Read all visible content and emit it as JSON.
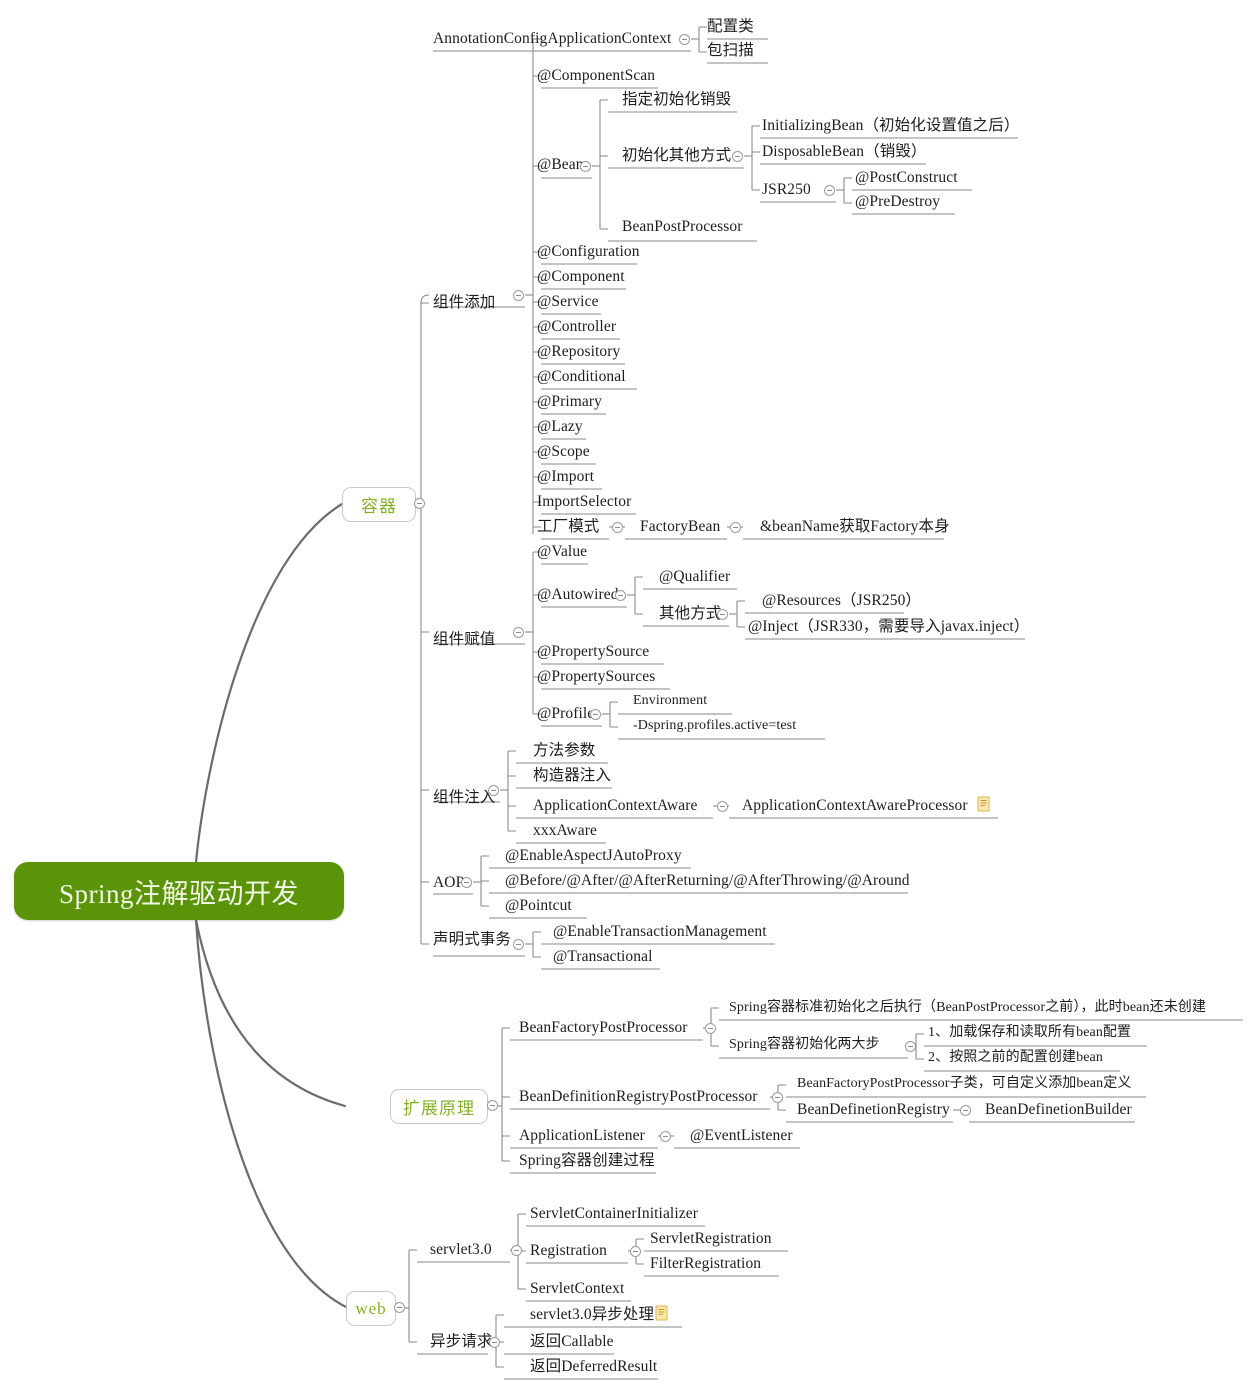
{
  "meta": {
    "title": "Spring注解驱动开发",
    "colors": {
      "root_bg": "#5b9409",
      "root_text": "#f2f7e6",
      "branch_text": "#84b12a",
      "branch_border": "#c9c9c9",
      "line": "#6b6b6b",
      "topic_text": "#1d1d1d",
      "note_icon": "#e8c45c"
    }
  },
  "root": {
    "label": "Spring注解驱动开发"
  },
  "branches": [
    {
      "id": "container",
      "label": "容器"
    },
    {
      "id": "extension",
      "label": "扩展原理"
    },
    {
      "id": "web",
      "label": "web"
    }
  ],
  "topics": {
    "t_annotation_config": "AnnotationConfigApplicationContext",
    "t_config_class": "配置类",
    "t_package_scan": "包扫描",
    "t_component_add": "组件添加",
    "t_component_scan": "@ComponentScan",
    "t_bean": "@Bean",
    "t_init_destroy": "指定初始化销毁",
    "t_init_other": "初始化其他方式",
    "t_initializing_bean": "InitializingBean（初始化设置值之后）",
    "t_disposable_bean": "DisposableBean（销毁）",
    "t_jsr250": "JSR250",
    "t_postconstruct": "@PostConstruct",
    "t_predestroy": "@PreDestroy",
    "t_bean_post_processor": "BeanPostProcessor",
    "t_configuration": "@Configuration",
    "t_component": "@Component",
    "t_service": "@Service",
    "t_controller": "@Controller",
    "t_repository": "@Repository",
    "t_conditional": "@Conditional",
    "t_primary": "@Primary",
    "t_lazy": "@Lazy",
    "t_scope": "@Scope",
    "t_import": "@Import",
    "t_import_selector": "ImportSelector",
    "t_factory_pattern": "工厂模式",
    "t_factory_bean": "FactoryBean",
    "t_beanname_factory": "&beanName获取Factory本身",
    "t_component_value": "组件赋值",
    "t_value": "@Value",
    "t_autowired": "@Autowired",
    "t_qualifier": "@Qualifier",
    "t_other_ways": "其他方式",
    "t_resources": "@Resources（JSR250）",
    "t_inject": "@Inject（JSR330，需要导入javax.inject）",
    "t_property_source": "@PropertySource",
    "t_property_sources": "@PropertySources",
    "t_profile": "@Profile",
    "t_environment": "Environment",
    "t_dspring": "-Dspring.profiles.active=test",
    "t_component_inject": "组件注入",
    "t_method_param": "方法参数",
    "t_constructor_inject": "构造器注入",
    "t_app_ctx_aware": "ApplicationContextAware",
    "t_app_ctx_aware_processor": "ApplicationContextAwareProcessor",
    "t_xxx_aware": "xxxAware",
    "t_aop": "AOP",
    "t_enable_aspectj": "@EnableAspectJAutoProxy",
    "t_advice_list": "@Before/@After/@AfterReturning/@AfterThrowing/@Around",
    "t_pointcut": "@Pointcut",
    "t_declarative_tx": "声明式事务",
    "t_enable_tx": "@EnableTransactionManagement",
    "t_transactional": "@Transactional",
    "t_bfpp": "BeanFactoryPostProcessor",
    "t_bfpp_desc": "Spring容器标准初始化之后执行（BeanPostProcessor之前），此时bean还未创建",
    "t_two_steps": "Spring容器初始化两大步",
    "t_step1": "1、加载保存和读取所有bean配置",
    "t_step2": "2、按照之前的配置创建bean",
    "t_bdrpp": "BeanDefinitionRegistryPostProcessor",
    "t_bdrpp_desc": "BeanFactoryPostProcessor子类，可自定义添加bean定义",
    "t_bd_registry": "BeanDefinetionRegistry",
    "t_bd_builder": "BeanDefinetionBuilder",
    "t_app_listener": "ApplicationListener",
    "t_event_listener": "@EventListener",
    "t_container_create": "Spring容器创建过程",
    "t_servlet3": "servlet3.0",
    "t_servlet_container_init": "ServletContainerInitializer",
    "t_registration": "Registration",
    "t_servlet_registration": "ServletRegistration",
    "t_filter_registration": "FilterRegistration",
    "t_servlet_context": "ServletContext",
    "t_async_request": "异步请求",
    "t_servlet3_async": "servlet3.0异步处理",
    "t_return_callable": "返回Callable",
    "t_return_deferred": "返回DeferredResult"
  }
}
